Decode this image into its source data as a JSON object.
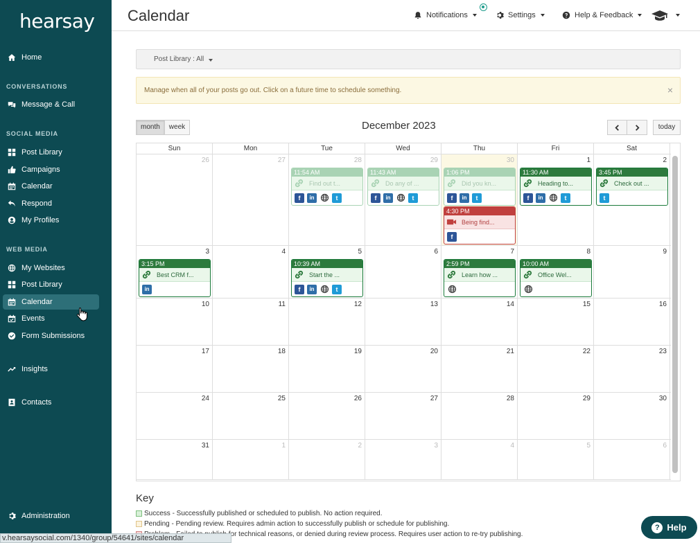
{
  "brand": {
    "logo_text": "hearsay"
  },
  "sidebar": {
    "top_items": [
      {
        "label": "Home",
        "icon": "home-icon"
      }
    ],
    "sections": [
      {
        "title": "CONVERSATIONS",
        "items": [
          {
            "label": "Message & Call",
            "icon": "message-icon"
          }
        ]
      },
      {
        "title": "SOCIAL MEDIA",
        "items": [
          {
            "label": "Post Library",
            "icon": "grid-icon"
          },
          {
            "label": "Campaigns",
            "icon": "thumbs-up-icon"
          },
          {
            "label": "Calendar",
            "icon": "calendar-icon"
          },
          {
            "label": "Respond",
            "icon": "reply-icon"
          },
          {
            "label": "My Profiles",
            "icon": "user-circle-icon"
          }
        ]
      },
      {
        "title": "WEB MEDIA",
        "items": [
          {
            "label": "My Websites",
            "icon": "globe-icon"
          },
          {
            "label": "Post Library",
            "icon": "grid-icon"
          },
          {
            "label": "Calendar",
            "icon": "calendar-icon",
            "active": true
          },
          {
            "label": "Events",
            "icon": "calendar-check-icon"
          },
          {
            "label": "Form Submissions",
            "icon": "check-circle-icon"
          }
        ]
      }
    ],
    "insights": "Insights",
    "contacts": "Contacts",
    "administration": "Administration"
  },
  "topbar": {
    "title": "Calendar",
    "notifications": "Notifications",
    "settings": "Settings",
    "help": "Help & Feedback"
  },
  "filter": {
    "label": "Post Library : All"
  },
  "alert": {
    "text": "Manage when all of your posts go out. Click on a future time to schedule something.",
    "close": "×"
  },
  "calendar": {
    "views": [
      "month",
      "week"
    ],
    "active_view": "month",
    "title": "December 2023",
    "today_label": "today",
    "days_of_week": [
      "Sun",
      "Mon",
      "Tue",
      "Wed",
      "Thu",
      "Fri",
      "Sat"
    ],
    "weeks": [
      [
        {
          "n": "26",
          "other": true
        },
        {
          "n": "27",
          "other": true
        },
        {
          "n": "28",
          "other": true
        },
        {
          "n": "29",
          "other": true
        },
        {
          "n": "30",
          "other": true,
          "today": true
        },
        {
          "n": "1"
        },
        {
          "n": "2"
        }
      ],
      [
        {
          "n": "3"
        },
        {
          "n": "4"
        },
        {
          "n": "5"
        },
        {
          "n": "6"
        },
        {
          "n": "7"
        },
        {
          "n": "8"
        },
        {
          "n": "9"
        }
      ],
      [
        {
          "n": "10"
        },
        {
          "n": "11"
        },
        {
          "n": "12"
        },
        {
          "n": "13"
        },
        {
          "n": "14"
        },
        {
          "n": "15"
        },
        {
          "n": "16"
        }
      ],
      [
        {
          "n": "17"
        },
        {
          "n": "18"
        },
        {
          "n": "19"
        },
        {
          "n": "20"
        },
        {
          "n": "21"
        },
        {
          "n": "22"
        },
        {
          "n": "23"
        }
      ],
      [
        {
          "n": "24"
        },
        {
          "n": "25"
        },
        {
          "n": "26"
        },
        {
          "n": "27"
        },
        {
          "n": "28"
        },
        {
          "n": "29"
        },
        {
          "n": "30"
        }
      ],
      [
        {
          "n": "31"
        },
        {
          "n": "1",
          "other": true
        },
        {
          "n": "2",
          "other": true
        },
        {
          "n": "3",
          "other": true
        },
        {
          "n": "4",
          "other": true
        },
        {
          "n": "5",
          "other": true
        },
        {
          "n": "6",
          "other": true
        }
      ]
    ],
    "events": [
      {
        "week": 0,
        "day": 2,
        "slot": 0,
        "time": "11:54 AM",
        "text": "Find out t...",
        "kind": "link",
        "status": "past",
        "networks": [
          "fb",
          "li",
          "web",
          "tw"
        ]
      },
      {
        "week": 0,
        "day": 3,
        "slot": 0,
        "time": "11:43 AM",
        "text": "Do any of ...",
        "kind": "link",
        "status": "past",
        "networks": [
          "fb",
          "li",
          "web",
          "tw"
        ]
      },
      {
        "week": 0,
        "day": 4,
        "slot": 0,
        "time": "1:06 PM",
        "text": "Did you kn...",
        "kind": "link",
        "status": "past",
        "networks": [
          "fb",
          "li",
          "tw"
        ]
      },
      {
        "week": 0,
        "day": 4,
        "slot": 1,
        "time": "4:30 PM",
        "text": "Being find...",
        "kind": "video",
        "status": "problem",
        "networks": [
          "fb"
        ]
      },
      {
        "week": 0,
        "day": 5,
        "slot": 0,
        "time": "11:30 AM",
        "text": "Heading to...",
        "kind": "link",
        "status": "success",
        "networks": [
          "fb",
          "li",
          "web",
          "tw"
        ]
      },
      {
        "week": 0,
        "day": 6,
        "slot": 0,
        "time": "3:45 PM",
        "text": "Check out ...",
        "kind": "link",
        "status": "success",
        "networks": [
          "tw"
        ]
      },
      {
        "week": 1,
        "day": 0,
        "slot": 0,
        "time": "3:15 PM",
        "text": "Best CRM f...",
        "kind": "link",
        "status": "success",
        "networks": [
          "li"
        ]
      },
      {
        "week": 1,
        "day": 2,
        "slot": 0,
        "time": "10:39 AM",
        "text": "Start the ...",
        "kind": "link",
        "status": "success",
        "networks": [
          "fb",
          "li",
          "web",
          "tw"
        ]
      },
      {
        "week": 1,
        "day": 4,
        "slot": 0,
        "time": "2:59 PM",
        "text": "Learn how ...",
        "kind": "link",
        "status": "success",
        "networks": [
          "web"
        ]
      },
      {
        "week": 1,
        "day": 5,
        "slot": 0,
        "time": "10:00 AM",
        "text": "Office Wel...",
        "kind": "link",
        "status": "success",
        "networks": [
          "web"
        ]
      }
    ]
  },
  "key": {
    "title": "Key",
    "items": [
      {
        "text": "Success - Successfully published or scheduled to publish. No action required.",
        "color": "#d8f0d8",
        "border": "#7fbf7f"
      },
      {
        "text": "Pending - Pending review. Requires admin action to successfully publish or schedule for publishing.",
        "color": "#fcf3dd",
        "border": "#e0c48a"
      },
      {
        "text": "Problem - Failed to publish for technical reasons, or denied during review process. Requires user action to re-try publishing.",
        "color": "#f6d7d7",
        "border": "#d08080"
      }
    ]
  },
  "status_url": "v.hearsaysocial.com/1340/group/54641/sites/calendar",
  "help_button": {
    "q": "?",
    "label": "Help"
  },
  "colors": {
    "sidebar_bg": "#0d4a52",
    "success": "#2d7a3d",
    "problem": "#c0403e"
  }
}
